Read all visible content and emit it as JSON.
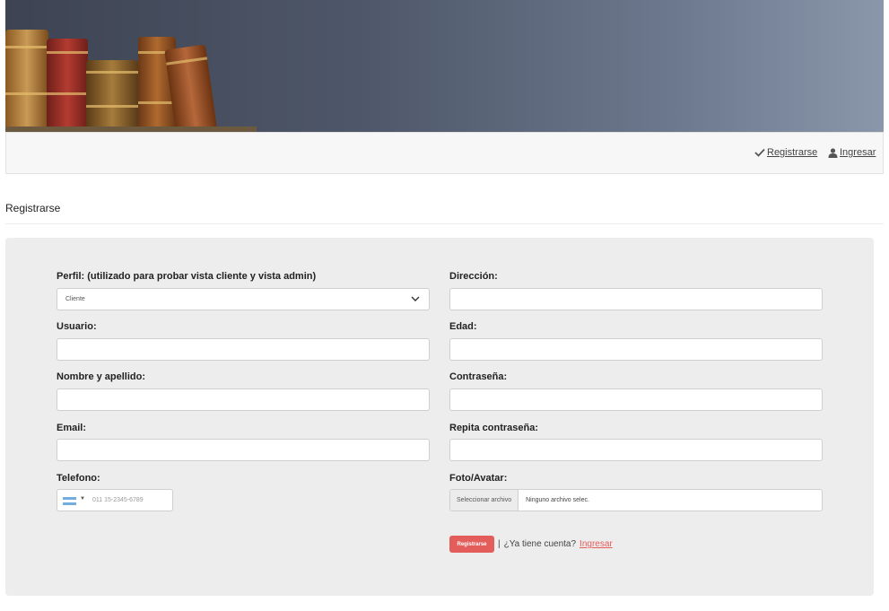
{
  "nav": {
    "register_label": "Registrarse",
    "login_label": "Ingresar"
  },
  "page": {
    "title": "Registrarse"
  },
  "form": {
    "perfil": {
      "label": "Perfil: (utilizado para probar vista cliente y vista admin)",
      "selected": "Cliente"
    },
    "usuario": {
      "label": "Usuario:",
      "value": ""
    },
    "nombre": {
      "label": "Nombre y apellido:",
      "value": ""
    },
    "email": {
      "label": "Email:",
      "value": ""
    },
    "telefono": {
      "label": "Telefono:",
      "placeholder": "011 15-2345-6789",
      "country_caret": "▼"
    },
    "direccion": {
      "label": "Dirección:",
      "value": ""
    },
    "edad": {
      "label": "Edad:",
      "value": ""
    },
    "contrasena": {
      "label": "Contraseña:",
      "value": ""
    },
    "repita": {
      "label": "Repita contraseña:",
      "value": ""
    },
    "foto": {
      "label": "Foto/Avatar:",
      "button_label": "Seleccionar archivo",
      "status": "Ninguno archivo selec."
    },
    "submit_label": "Registrarse",
    "separator": "|",
    "account_question": "¿Ya tiene cuenta?",
    "login_link": "Ingresar"
  },
  "colors": {
    "accent": "#e35d5b",
    "panel_bg": "#ededed",
    "navbar_bg": "#f7f7f7"
  }
}
